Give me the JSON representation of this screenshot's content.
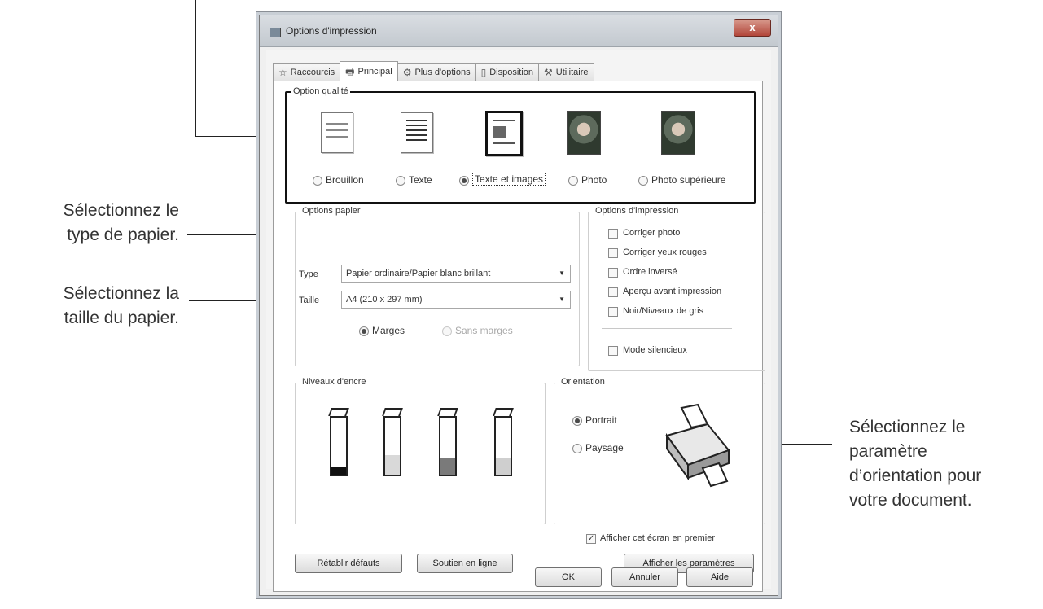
{
  "annotations": {
    "paper_type": [
      "Sélectionnez le",
      "type de papier."
    ],
    "paper_size": [
      "Sélectionnez la",
      "taille du papier."
    ],
    "orientation": [
      "Sélectionnez le",
      "paramètre",
      "d’orientation pour",
      "votre document."
    ]
  },
  "window": {
    "title": "Options d'impression",
    "close": "x"
  },
  "tabs": [
    {
      "label": "Raccourcis",
      "icon": "star-icon"
    },
    {
      "label": "Principal",
      "icon": "printer-icon"
    },
    {
      "label": "Plus d'options",
      "icon": "gears-icon"
    },
    {
      "label": "Disposition",
      "icon": "layout-icon"
    },
    {
      "label": "Utilitaire",
      "icon": "wrench-icon"
    }
  ],
  "quality": {
    "legend": "Option qualité",
    "options": [
      "Brouillon",
      "Texte",
      "Texte et images",
      "Photo",
      "Photo supérieure"
    ],
    "selected": "Texte et images"
  },
  "paper": {
    "legend": "Options papier",
    "type_label": "Type",
    "type_value": "Papier ordinaire/Papier blanc brillant",
    "size_label": "Taille",
    "size_value": "A4 (210 x 297 mm)",
    "margins": "Marges",
    "borderless": "Sans marges"
  },
  "print_options": {
    "legend": "Options d'impression",
    "items": [
      "Corriger photo",
      "Corriger yeux rouges",
      "Ordre inversé",
      "Aperçu avant impression",
      "Noir/Niveaux de gris"
    ],
    "quiet": "Mode silencieux"
  },
  "ink": {
    "legend": "Niveaux d'encre",
    "levels": [
      0.15,
      0.35,
      0.3,
      0.3
    ],
    "colors": [
      "#111111",
      "#d9d9d9",
      "#7a7a7a",
      "#cfcfcf"
    ]
  },
  "orientation": {
    "legend": "Orientation",
    "portrait": "Portrait",
    "landscape": "Paysage",
    "selected": "Portrait"
  },
  "footer": {
    "show_first": "Afficher cet écran en premier",
    "show_first_checked": true,
    "restore": "Rétablir défauts",
    "online": "Soutien en ligne",
    "show_settings": "Afficher les paramètres",
    "ok": "OK",
    "cancel": "Annuler",
    "help": "Aide"
  }
}
